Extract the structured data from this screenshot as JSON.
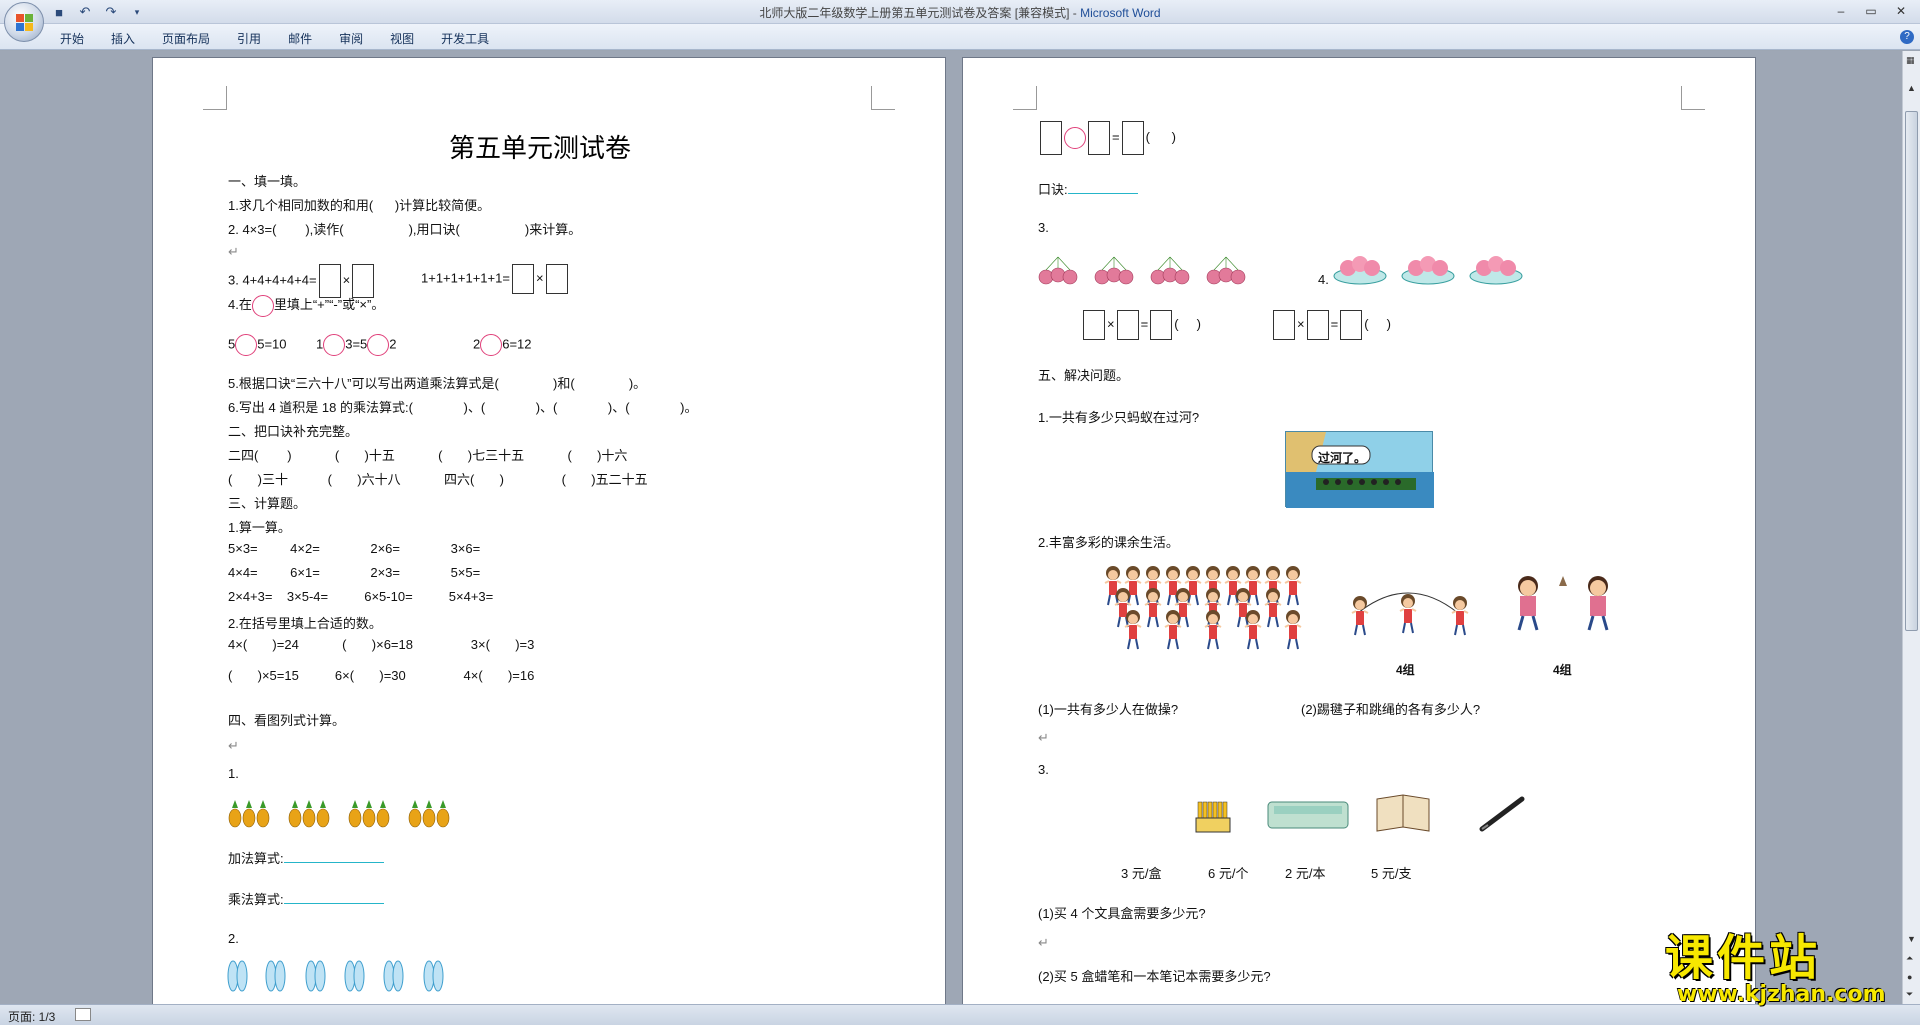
{
  "window": {
    "title": "北师大版二年级数学上册第五单元测试卷及答案 [兼容模式]",
    "app_sep": " - ",
    "app_name": "Microsoft Word"
  },
  "qat": {
    "save_icon": "save-icon",
    "undo_icon": "undo-icon",
    "redo_icon": "redo-icon"
  },
  "menu": {
    "tabs": [
      "开始",
      "插入",
      "页面布局",
      "引用",
      "邮件",
      "审阅",
      "视图",
      "开发工具"
    ],
    "help": "?"
  },
  "page1": {
    "title": "第五单元测试卷",
    "lines": [
      "一、填一填。",
      "1.求几个相同加数的和用(      )计算比较简便。",
      "2. 4×3=(        ),读作(                  ),用口诀(                  )来计算。",
      "3. 4+4+4+4+4=",
      "1+1+1+1+1+1=",
      "4.在",
      "里填上“+”“-”或“×”。",
      "5",
      "5=10",
      "1",
      "3=5",
      "2",
      "2",
      "6=12",
      "5.根据口诀“三六十八”可以写出两道乘法算式是(               )和(               )。",
      "6.写出 4 道积是 18 的乘法算式:(              )、(              )、(              )、(              )。",
      "二、把口诀补充完整。",
      "二四(        )            (       )十五            (       )七三十五            (       )十六",
      "(       )三十           (       )六十八            四六(       )                (       )五二十五",
      "三、计算题。",
      "1.算一算。",
      "5×3=         4×2=              2×6=              3×6=",
      "4×4=         6×1=              2×3=              5×5=",
      "2×4+3=    3×5-4=          6×5-10=          5×4+3=",
      "2.在括号里填上合适的数。",
      "4×(       )=24            (       )×6=18                3×(       )=3",
      "(       )×5=15          6×(       )=30                4×(       )=16",
      "四、看图列式计算。",
      "1.",
      "加法算式:",
      "乘法算式:",
      "2."
    ]
  },
  "page2": {
    "lines": [
      "(      )",
      "口诀:",
      "3.",
      "4.",
      "(     )",
      "(     )",
      "五、解决问题。",
      "1.一共有多少只蚂蚁在过河?",
      "过河了。",
      "2.丰富多彩的课余生活。",
      "4组",
      "4组",
      "(1)一共有多少人在做操?",
      "(2)踢毽子和跳绳的各有多少人?",
      "3.",
      "3 元/盒",
      "6 元/个",
      "2 元/本",
      "5 元/支",
      "(1)买 4 个文具盒需要多少元?",
      "(2)买 5 盒蜡笔和一本笔记本需要多少元?"
    ]
  },
  "status": {
    "page": "页面: 1/3"
  },
  "watermark": {
    "cn": "课件站",
    "url": "www.kjzhan.com"
  },
  "colors": {
    "accent": "#1f4e98",
    "circle": "#e0407a",
    "underline": "#25b5c9",
    "watermark": "#f7e800"
  }
}
